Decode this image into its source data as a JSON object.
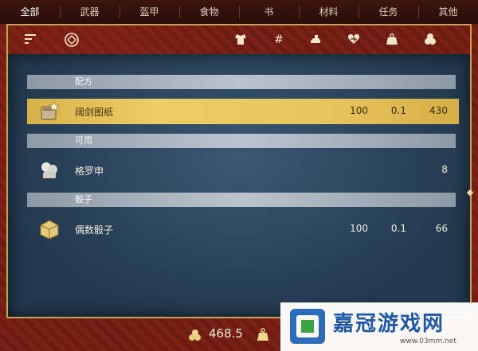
{
  "tabs": [
    {
      "label": "全部",
      "active": true
    },
    {
      "label": "武器",
      "active": false
    },
    {
      "label": "盔甲",
      "active": false
    },
    {
      "label": "食物",
      "active": false
    },
    {
      "label": "书",
      "active": false
    },
    {
      "label": "材料",
      "active": false
    },
    {
      "label": "任务",
      "active": false
    },
    {
      "label": "其他",
      "active": false
    }
  ],
  "iconbar": {
    "icons": [
      "sort-icon",
      "filter-icon",
      "armor-icon",
      "hash-icon",
      "strength-icon",
      "health-icon",
      "weight-icon",
      "value-icon"
    ],
    "hash_glyph": "#"
  },
  "sections": [
    {
      "title": "配方",
      "items": [
        {
          "name": "阔剑图纸",
          "icon": "scroll-icon",
          "col1": "100",
          "col2": "0.1",
          "col3": "430",
          "selected": true
        }
      ]
    },
    {
      "title": "可用",
      "items": [
        {
          "name": "格罗申",
          "icon": "coin-bag-icon",
          "col1": "",
          "col2": "",
          "col3": "8",
          "selected": false
        }
      ]
    },
    {
      "title": "骰子",
      "items": [
        {
          "name": "偶数骰子",
          "icon": "dice-icon",
          "col1": "100",
          "col2": "0.1",
          "col3": "66",
          "selected": false
        }
      ]
    }
  ],
  "footer": {
    "money": "468.5"
  },
  "watermark": {
    "title": "嘉冠游戏网",
    "url": "www.03mm.net"
  },
  "colors": {
    "frame_red": "#7a2115",
    "panel_blue": "#2c4560",
    "selected_gold": "#e8c55a",
    "watermark_blue": "#1e5aa7"
  }
}
